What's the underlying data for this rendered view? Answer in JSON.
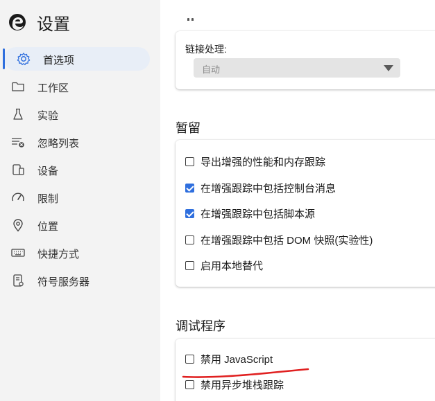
{
  "app": {
    "title": "设置",
    "logo_icon": "edge-logo-icon"
  },
  "sidebar": {
    "items": [
      {
        "label": "首选项",
        "icon": "gear-icon",
        "active": true
      },
      {
        "label": "工作区",
        "icon": "folder-icon"
      },
      {
        "label": "实验",
        "icon": "flask-icon"
      },
      {
        "label": "忽略列表",
        "icon": "ignore-list-icon"
      },
      {
        "label": "设备",
        "icon": "devices-icon"
      },
      {
        "label": "限制",
        "icon": "gauge-icon"
      },
      {
        "label": "位置",
        "icon": "location-pin-icon"
      },
      {
        "label": "快捷方式",
        "icon": "keyboard-icon"
      },
      {
        "label": "符号服务器",
        "icon": "symbol-server-icon"
      }
    ]
  },
  "main": {
    "link_handling": {
      "label": "链接处理:",
      "value": "自动"
    },
    "persistence": {
      "title": "暂留",
      "options": [
        {
          "label": "导出增强的性能和内存跟踪",
          "checked": false
        },
        {
          "label": "在增强跟踪中包括控制台消息",
          "checked": true
        },
        {
          "label": "在增强跟踪中包括脚本源",
          "checked": true
        },
        {
          "label": "在增强跟踪中包括 DOM 快照(实验性)",
          "checked": false
        },
        {
          "label": "启用本地替代",
          "checked": false
        }
      ]
    },
    "debugger": {
      "title": "调试程序",
      "options": [
        {
          "label": "禁用 JavaScript",
          "checked": false
        },
        {
          "label": "禁用异步堆栈跟踪",
          "checked": false
        }
      ]
    }
  },
  "colors": {
    "accent": "#2f6fde",
    "annotation": "#e02020",
    "sidebar_bg": "#f3f3f3"
  }
}
